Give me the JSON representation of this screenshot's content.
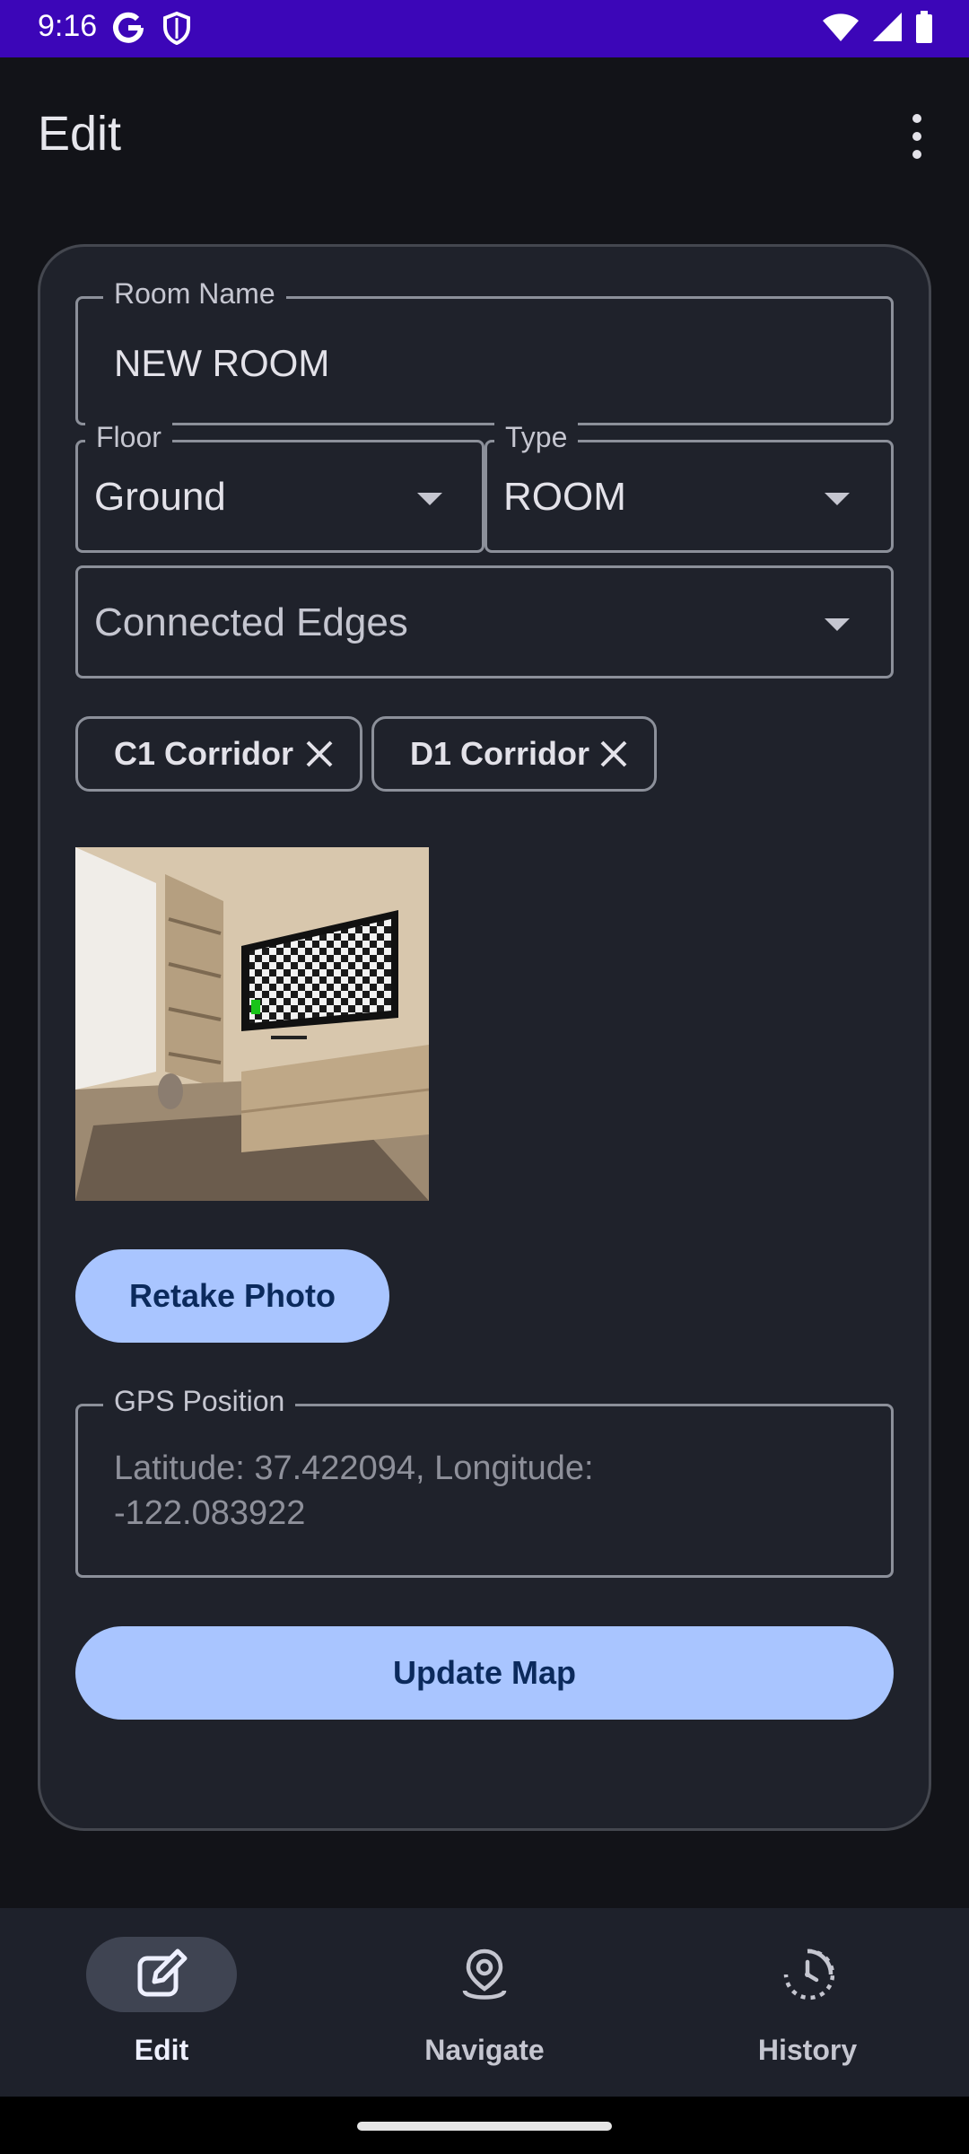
{
  "status": {
    "time": "9:16",
    "icons_left": [
      "google-icon",
      "shield-icon"
    ],
    "icons_right": [
      "wifi-icon",
      "signal-icon",
      "battery-icon"
    ],
    "bar_color": "#3c06b8"
  },
  "app_bar": {
    "title": "Edit",
    "menu_icon": "more-vert-icon"
  },
  "form": {
    "room_name": {
      "label": "Room Name",
      "value": "NEW ROOM"
    },
    "floor": {
      "label": "Floor",
      "value": "Ground"
    },
    "type": {
      "label": "Type",
      "value": "ROOM"
    },
    "connected_edges": {
      "placeholder": "Connected Edges"
    },
    "chips": [
      {
        "label": "C1 Corridor"
      },
      {
        "label": "D1 Corridor"
      }
    ],
    "photo": {
      "description_icon": "room-photo"
    },
    "retake_button": "Retake Photo",
    "gps": {
      "label": "GPS Position",
      "line1": "Latitude: 37.422094, Longitude:",
      "line2": "-122.083922"
    },
    "update_button": "Update Map"
  },
  "nav": {
    "items": [
      {
        "label": "Edit",
        "icon": "edit-icon",
        "active": true
      },
      {
        "label": "Navigate",
        "icon": "navigate-icon",
        "active": false
      },
      {
        "label": "History",
        "icon": "history-icon",
        "active": false
      }
    ]
  },
  "colors": {
    "accent": "#a9c5ff",
    "background": "#121318",
    "card": "#1f222b"
  }
}
